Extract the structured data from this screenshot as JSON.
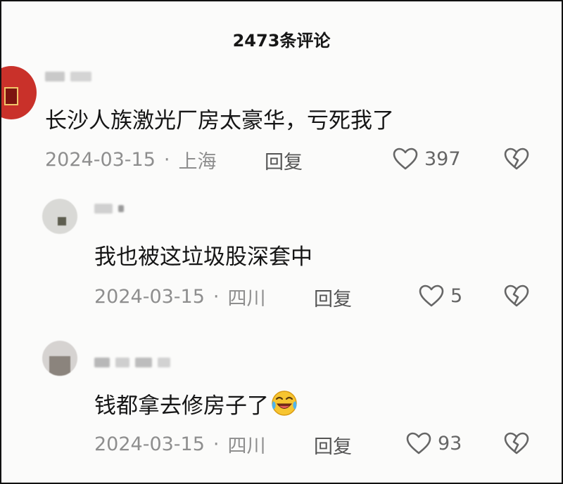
{
  "header": {
    "title": "2473条评论"
  },
  "comments": [
    {
      "username": "",
      "content": "长沙人族激光厂房太豪华，亏死我了",
      "date": "2024-03-15",
      "separator": "·",
      "location": "上海",
      "reply_label": "回复",
      "likes": "397"
    },
    {
      "username": "",
      "content": "我也被这垃圾股深套中",
      "date": "2024-03-15",
      "separator": "·",
      "location": "四川",
      "reply_label": "回复",
      "likes": "5"
    },
    {
      "username": "",
      "content": "钱都拿去修房子了",
      "emoji": "laughing-crying-emoji",
      "date": "2024-03-15",
      "separator": "·",
      "location": "四川",
      "reply_label": "回复",
      "likes": "93"
    }
  ],
  "icons": {
    "like": "heart-outline-icon",
    "dislike": "broken-heart-icon"
  },
  "colors": {
    "text_primary": "#151515",
    "text_meta": "#8e8e8e",
    "reply": "#555555",
    "avatar_red": "#c9312a"
  }
}
